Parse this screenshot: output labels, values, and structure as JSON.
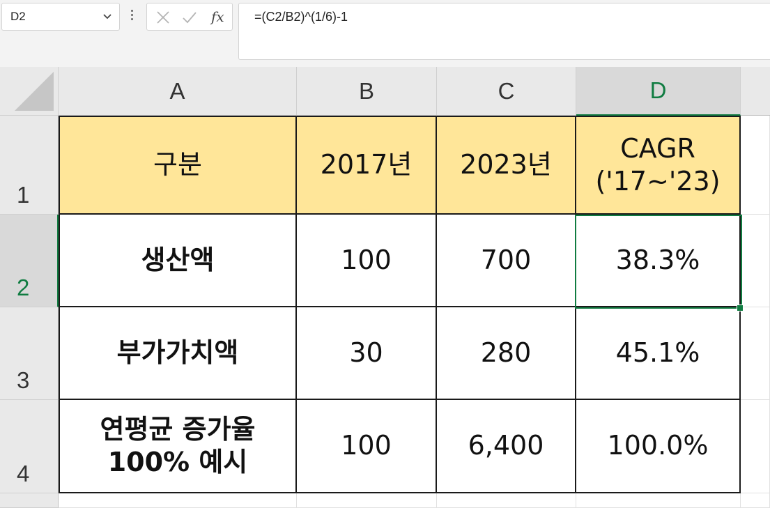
{
  "formula_bar": {
    "name_box": "D2",
    "cancel_icon": "close-icon",
    "enter_icon": "check-icon",
    "fx_label": "fx",
    "formula": "=(C2/B2)^(1/6)-1"
  },
  "columns": [
    "A",
    "B",
    "C",
    "D"
  ],
  "rows": [
    "1",
    "2",
    "3",
    "4"
  ],
  "selected_cell": "D2",
  "colors": {
    "header_fill": "#ffe699",
    "selection": "#107c41"
  },
  "table": {
    "header": {
      "a": "구분",
      "b": "2017년",
      "c": "2023년",
      "d_line1": "CAGR",
      "d_line2": "('17~'23)"
    },
    "row2": {
      "a": "생산액",
      "b": "100",
      "c": "700",
      "d": "38.3%"
    },
    "row3": {
      "a": "부가가치액",
      "b": "30",
      "c": "280",
      "d": "45.1%"
    },
    "row4": {
      "a_line1": "연평균 증가율",
      "a_line2": "100% 예시",
      "b": "100",
      "c": "6,400",
      "d": "100.0%"
    }
  }
}
